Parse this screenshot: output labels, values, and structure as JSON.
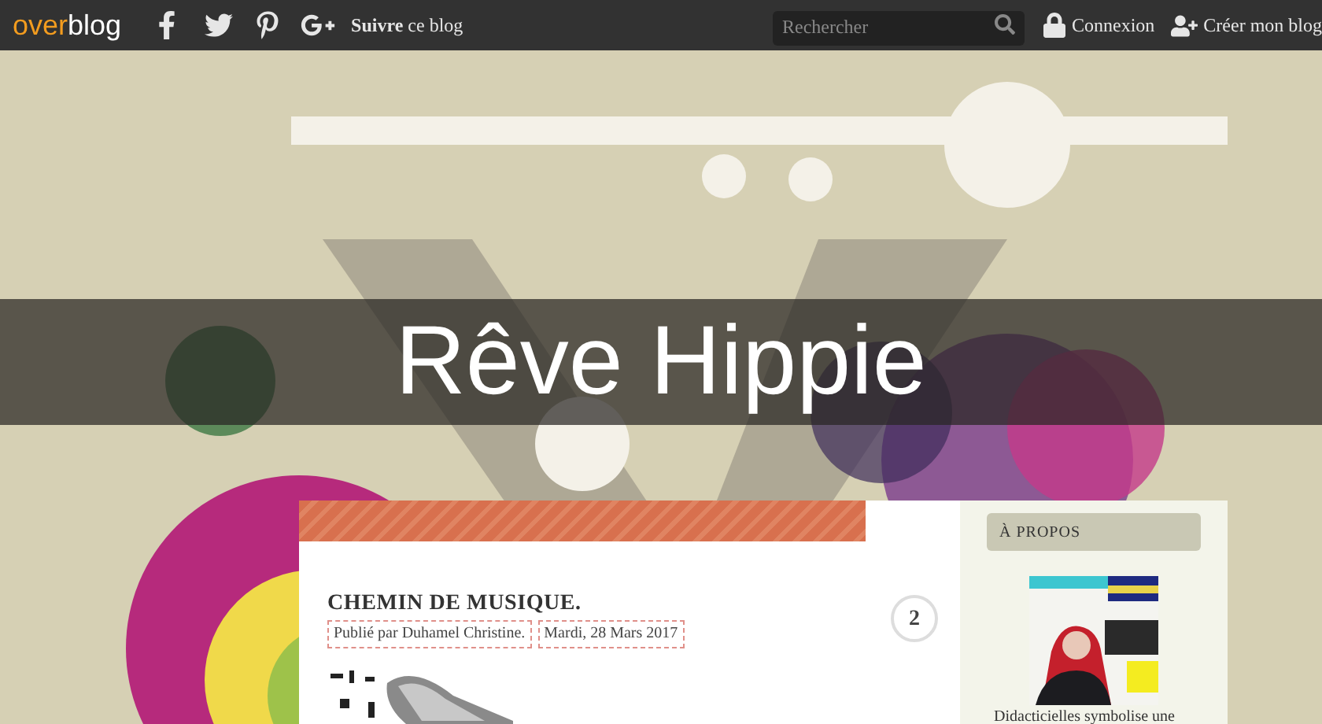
{
  "topbar": {
    "logo": {
      "first": "over",
      "second": "blog"
    },
    "follow": "**Suivre** ce blog",
    "search": {
      "placeholder": "Rechercher"
    },
    "login": "Connexion",
    "signup": "Créer mon blog"
  },
  "blog_title": "Rêve Hippie",
  "post": {
    "title": "CHEMIN DE MUSIQUE.",
    "author": "Publié par Duhamel Christine.",
    "date": "Mardi, 28 Mars 2017",
    "comments": "2"
  },
  "sidebar": {
    "heading": "À PROPOS",
    "text": "Didacticielles symbolise une"
  }
}
